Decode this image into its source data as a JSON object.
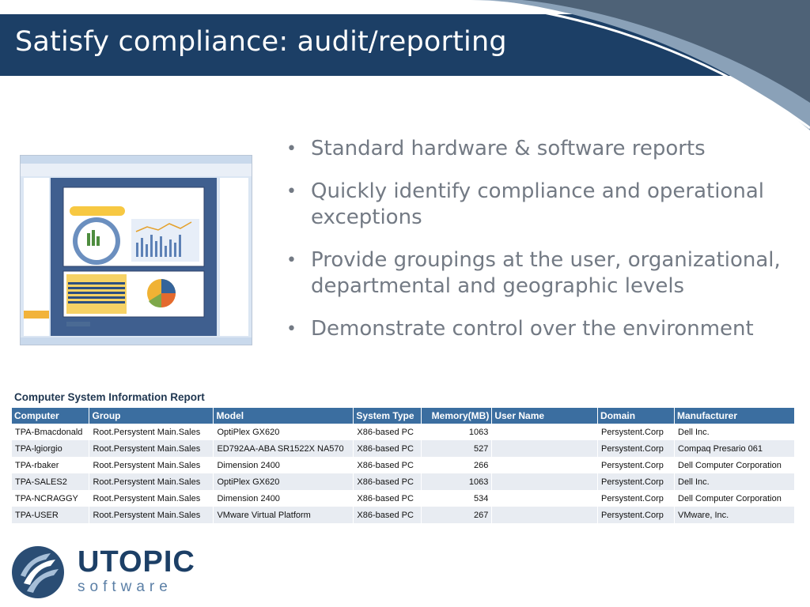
{
  "slide": {
    "title": "Satisfy compliance: audit/reporting"
  },
  "bullets": [
    "Standard hardware & software reports",
    "Quickly identify compliance and operational exceptions",
    "Provide groupings at the user, organizational, departmental and geographic levels",
    "Demonstrate control over the environment"
  ],
  "report": {
    "title": "Computer System Information Report",
    "columns": [
      "Computer",
      "Group",
      "Model",
      "System Type",
      "Memory(MB)",
      "User Name",
      "Domain",
      "Manufacturer"
    ],
    "rows": [
      [
        "TPA-Bmacdonald",
        "Root.Persystent Main.Sales",
        "OptiPlex GX620",
        "X86-based PC",
        "1063",
        "",
        "Persystent.Corp",
        "Dell Inc."
      ],
      [
        "TPA-lgiorgio",
        "Root.Persystent Main.Sales",
        "ED792AA-ABA SR1522X NA570",
        "X86-based PC",
        "527",
        "",
        "Persystent.Corp",
        "Compaq Presario 061"
      ],
      [
        "TPA-rbaker",
        "Root.Persystent Main.Sales",
        "Dimension 2400",
        "X86-based PC",
        "266",
        "",
        "Persystent.Corp",
        "Dell Computer Corporation"
      ],
      [
        "TPA-SALES2",
        "Root.Persystent Main.Sales",
        "OptiPlex GX620",
        "X86-based PC",
        "1063",
        "",
        "Persystent.Corp",
        "Dell Inc."
      ],
      [
        "TPA-NCRAGGY",
        "Root.Persystent Main.Sales",
        "Dimension 2400",
        "X86-based PC",
        "534",
        "",
        "Persystent.Corp",
        "Dell Computer Corporation"
      ],
      [
        "TPA-USER",
        "Root.Persystent Main.Sales",
        "VMware Virtual Platform",
        "X86-based PC",
        "267",
        "",
        "Persystent.Corp",
        "VMware, Inc."
      ]
    ]
  },
  "logo": {
    "word": "UTOPIC",
    "sub": "software",
    "icon": "utopic-logo-icon"
  },
  "colors": {
    "title_bar": "#1c3f66",
    "table_header": "#3b6ea0",
    "bullet_text": "#737a84"
  }
}
